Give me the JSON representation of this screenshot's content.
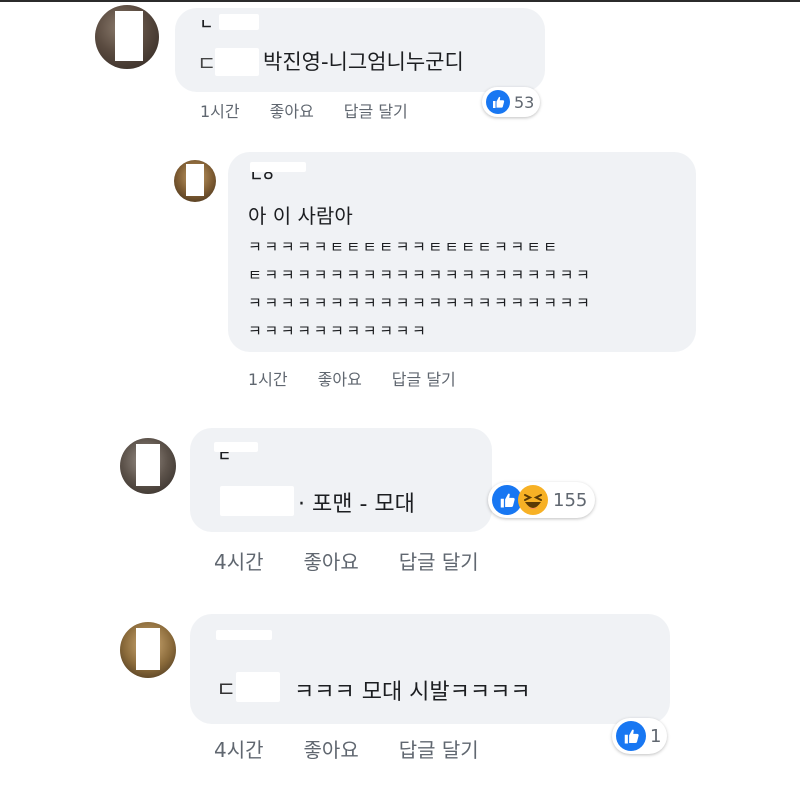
{
  "comments": [
    {
      "name": "ㄴ",
      "text_prefix": "ㄷ",
      "text": "박진영-니그엄니누군디",
      "time": "1시간",
      "like_label": "좋아요",
      "reply_label": "답글 달기",
      "reaction_count": "53",
      "reactions": [
        "like-icon"
      ]
    },
    {
      "name": "ㄴㅇ",
      "text_lines": [
        "아 이 사람아",
        "ㅋㅋㅋㅋㅋㅌㅌㅌㅌㅋㅋㅌㅌㅌㅌㅋㅋㅌㅌ",
        "ㅌㅋㅋㅋㅋㅋㅋㅋㅋㅋㅋㅋㅋㅋㅋㅋㅋㅋㅋㅋㅋ",
        "ㅋㅋㅋㅋㅋㅋㅋㅋㅋㅋㅋㅋㅋㅋㅋㅋㅋㅋㅋㅋㅋ",
        "ㅋㅋㅋㅋㅋㅋㅋㅋㅋㅋㅋ"
      ],
      "time": "1시간",
      "like_label": "좋아요",
      "reply_label": "답글 달기"
    },
    {
      "name": "ㄷ",
      "text": "· 포맨 - 모대",
      "time": "4시간",
      "like_label": "좋아요",
      "reply_label": "답글 달기",
      "reaction_count": "155",
      "reactions": [
        "like-icon",
        "haha-icon"
      ]
    },
    {
      "name": "",
      "text_prefix": "ㄷ",
      "text": "ㅋㅋㅋ 모대 시발ㅋㅋㅋㅋ",
      "time": "4시간",
      "like_label": "좋아요",
      "reply_label": "답글 달기",
      "reaction_count": "1",
      "reactions": [
        "like-icon"
      ]
    }
  ],
  "colors": {
    "bubble": "#f0f2f5",
    "like_blue": "#1877f2",
    "haha_yellow": "#f7b125",
    "meta_gray": "#606770"
  }
}
